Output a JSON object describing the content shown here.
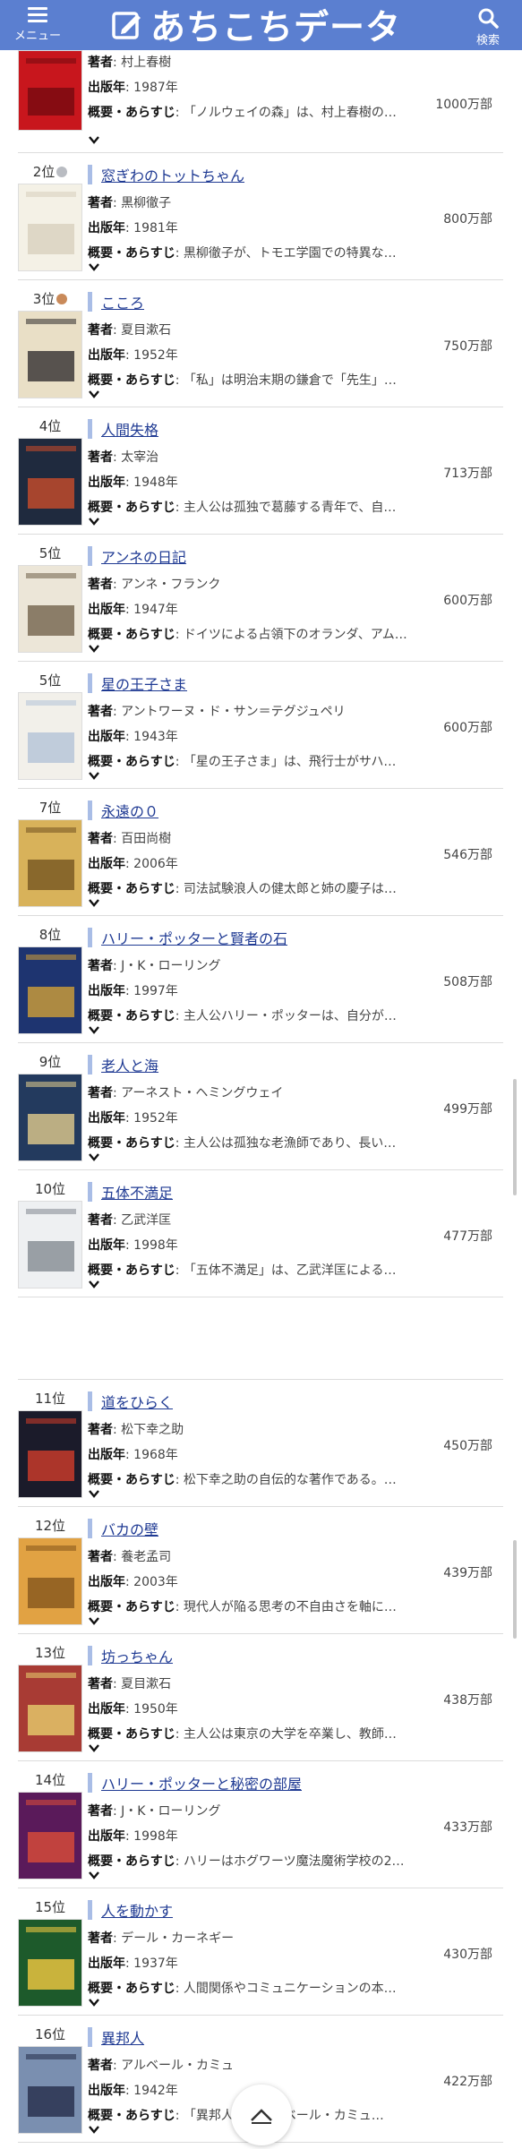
{
  "header": {
    "menu_label": "メニュー",
    "logo_text": "あちこちデータ",
    "search_label": "検索"
  },
  "labels": {
    "author": "著者",
    "year": "出版年",
    "summary": "概要・あらすじ",
    "colon": ": "
  },
  "books": [
    {
      "rank": "",
      "title": "",
      "author": "村上春樹",
      "year": "1987年",
      "summary": "「ノルウェイの森」は、村上春樹の…",
      "sales": "1000万部",
      "medal": ""
    },
    {
      "rank": "2位",
      "title": "窓ぎわのトットちゃん",
      "author": "黒柳徹子",
      "year": "1981年",
      "summary": "黒柳徹子が、トモエ学園での特異な…",
      "sales": "800万部",
      "medal": "#b9bcc2"
    },
    {
      "rank": "3位",
      "title": "こころ",
      "author": "夏目漱石",
      "year": "1952年",
      "summary": "「私」は明治末期の鎌倉で「先生」…",
      "sales": "750万部",
      "medal": "#c98a5a"
    },
    {
      "rank": "4位",
      "title": "人間失格",
      "author": "太宰治",
      "year": "1948年",
      "summary": "主人公は孤独で葛藤する青年で、自…",
      "sales": "713万部",
      "medal": ""
    },
    {
      "rank": "5位",
      "title": "アンネの日記",
      "author": "アンネ・フランク",
      "year": "1947年",
      "summary": "ドイツによる占領下のオランダ、アム…",
      "sales": "600万部",
      "medal": ""
    },
    {
      "rank": "5位",
      "title": "星の王子さま",
      "author": "アントワーヌ・ド・サン＝テグジュペリ",
      "year": "1943年",
      "summary": "「星の王子さま」は、飛行士がサハ…",
      "sales": "600万部",
      "medal": ""
    },
    {
      "rank": "7位",
      "title": "永遠の０",
      "author": "百田尚樹",
      "year": "2006年",
      "summary": "司法試験浪人の健太郎と姉の慶子は…",
      "sales": "546万部",
      "medal": ""
    },
    {
      "rank": "8位",
      "title": "ハリー・ポッターと賢者の石",
      "author": "J・K・ローリング",
      "year": "1997年",
      "summary": "主人公ハリー・ポッターは、自分が…",
      "sales": "508万部",
      "medal": ""
    },
    {
      "rank": "9位",
      "title": "老人と海",
      "author": "アーネスト・ヘミングウェイ",
      "year": "1952年",
      "summary": "主人公は孤独な老漁師であり、長い…",
      "sales": "499万部",
      "medal": ""
    },
    {
      "rank": "10位",
      "title": "五体不満足",
      "author": "乙武洋匡",
      "year": "1998年",
      "summary": "「五体不満足」は、乙武洋匡による…",
      "sales": "477万部",
      "medal": ""
    },
    {
      "rank": "11位",
      "title": "道をひらく",
      "author": "松下幸之助",
      "year": "1968年",
      "summary": "松下幸之助の自伝的な著作である。…",
      "sales": "450万部",
      "medal": ""
    },
    {
      "rank": "12位",
      "title": "バカの壁",
      "author": "養老孟司",
      "year": "2003年",
      "summary": "現代人が陥る思考の不自由さを軸に…",
      "sales": "439万部",
      "medal": ""
    },
    {
      "rank": "13位",
      "title": "坊っちゃん",
      "author": "夏目漱石",
      "year": "1950年",
      "summary": "主人公は東京の大学を卒業し、教師…",
      "sales": "438万部",
      "medal": ""
    },
    {
      "rank": "14位",
      "title": "ハリー・ポッターと秘密の部屋",
      "author": "J・K・ローリング",
      "year": "1998年",
      "summary": "ハリーはホグワーツ魔法魔術学校の2…",
      "sales": "433万部",
      "medal": ""
    },
    {
      "rank": "15位",
      "title": "人を動かす",
      "author": "デール・カーネギー",
      "year": "1937年",
      "summary": "人間関係やコミュニケーションの本…",
      "sales": "430万部",
      "medal": ""
    },
    {
      "rank": "16位",
      "title": "異邦人",
      "author": "アルベール・カミュ",
      "year": "1942年",
      "summary": "「異邦人」…アルベール・カミュ…",
      "sales": "422万部",
      "medal": ""
    }
  ],
  "colors": {
    "header_bg": "#5b7fd0",
    "title_link": "#1f3a93",
    "title_bar": "#a9bde6"
  }
}
